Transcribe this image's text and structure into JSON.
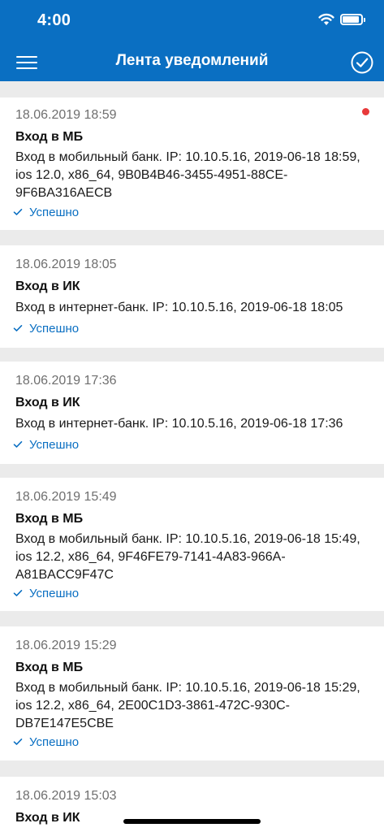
{
  "status_bar": {
    "time": "4:00"
  },
  "header": {
    "title": "Лента уведомлений"
  },
  "colors": {
    "brand": "#0a6fc2",
    "unread": "#e8393a"
  },
  "notifications": [
    {
      "date": "18.06.2019 18:59",
      "title": "Вход в МБ",
      "lines": [
        "Вход в мобильный банк. IP: 10.10.5.16, 2019-06-18 18:59,",
        "ios 12.0, x86_64, 9B0B4B46-3455-4951-88CE-",
        "9F6BA316AECB"
      ],
      "status": "Успешно",
      "unread": true
    },
    {
      "date": "18.06.2019 18:05",
      "title": "Вход в ИК",
      "lines": [
        "Вход в интернет-банк. IP: 10.10.5.16, 2019-06-18 18:05"
      ],
      "status": "Успешно",
      "unread": false
    },
    {
      "date": "18.06.2019 17:36",
      "title": "Вход в ИК",
      "lines": [
        "Вход в интернет-банк. IP: 10.10.5.16, 2019-06-18 17:36"
      ],
      "status": "Успешно",
      "unread": false
    },
    {
      "date": "18.06.2019 15:49",
      "title": "Вход в МБ",
      "lines": [
        "Вход в мобильный банк. IP: 10.10.5.16, 2019-06-18 15:49,",
        "ios 12.2, x86_64, 9F46FE79-7141-4A83-966A-",
        "A81BACC9F47C"
      ],
      "status": "Успешно",
      "unread": false
    },
    {
      "date": "18.06.2019 15:29",
      "title": "Вход в МБ",
      "lines": [
        "Вход в мобильный банк. IP: 10.10.5.16, 2019-06-18 15:29,",
        "ios 12.2, x86_64, 2E00C1D3-3861-472C-930C-",
        "DB7E147E5CBE"
      ],
      "status": "Успешно",
      "unread": false
    },
    {
      "date": "18.06.2019 15:03",
      "title": "Вход в ИК",
      "lines": [],
      "status": "",
      "unread": false
    }
  ]
}
